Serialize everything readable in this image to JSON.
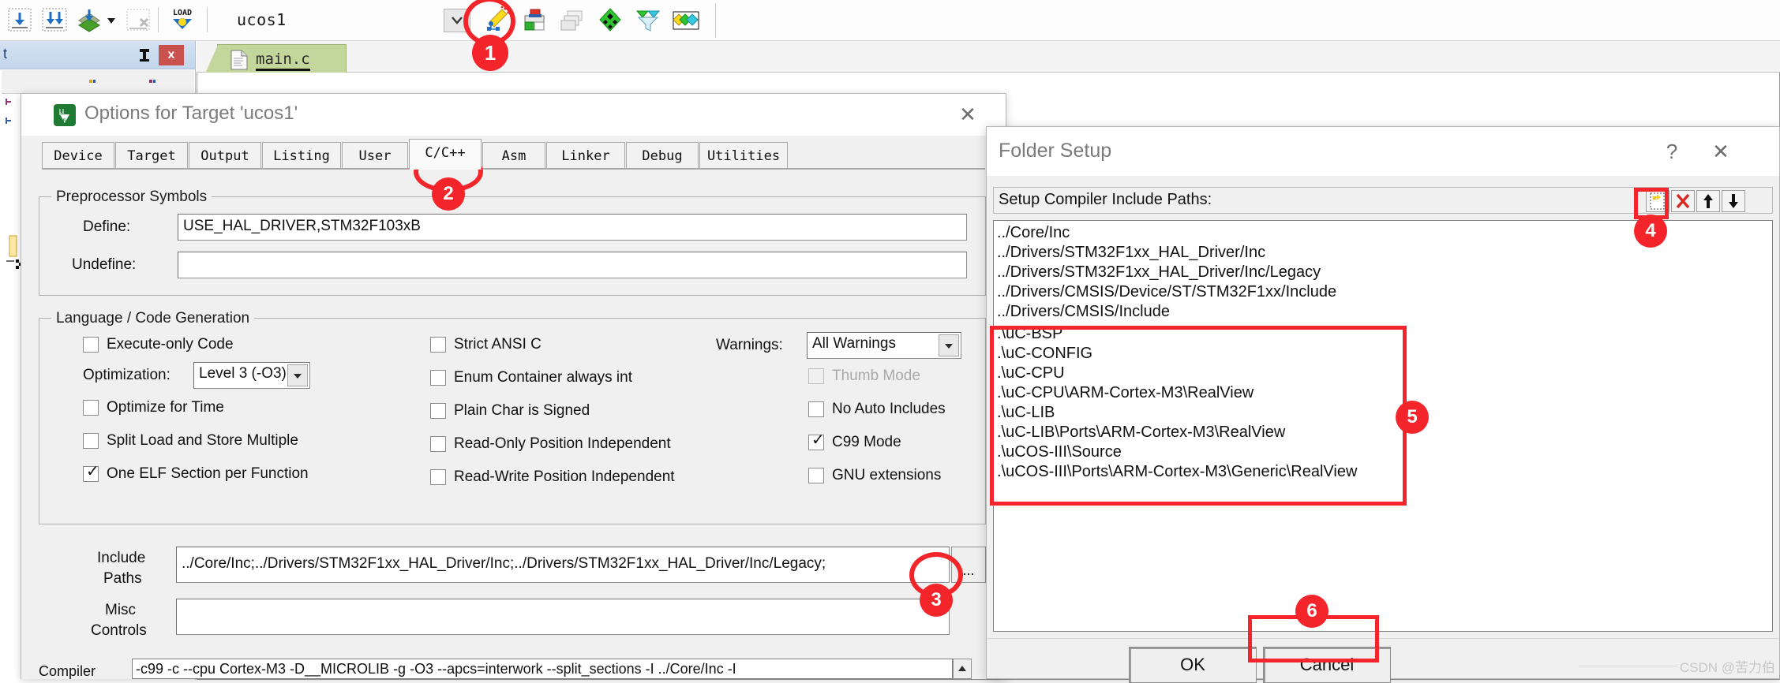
{
  "ide": {
    "project_name": "ucos1",
    "toolbar_icons": [
      "translate-file-icon",
      "build-target-icon",
      "rebuild-all-icon",
      "batch-build-dropdown-icon",
      "stop-build-icon",
      "load-flash-icon"
    ],
    "right_toolbar_icons": [
      "configure-target-wizard-icon",
      "manage-runtime-environment-icon",
      "manage-project-items-icon",
      "pack-installer-green-icon",
      "pack-filter-icon",
      "multi-project-icon"
    ],
    "project_combo_icon": "chevron-down-icon"
  },
  "left_panel": {
    "caption": "t",
    "pin_icon": "pin-icon",
    "close_icon": "close-icon"
  },
  "editor": {
    "tab_label": "main.c",
    "tab_icon": "c-file-icon"
  },
  "options_dialog": {
    "icon": "uvision5-icon",
    "title": "Options for Target 'ucos1'",
    "close_icon": "close-icon",
    "tabs": [
      {
        "label": "Device",
        "active": false
      },
      {
        "label": "Target",
        "active": false
      },
      {
        "label": "Output",
        "active": false
      },
      {
        "label": "Listing",
        "active": false
      },
      {
        "label": "User",
        "active": false
      },
      {
        "label": "C/C++",
        "active": true
      },
      {
        "label": "Asm",
        "active": false
      },
      {
        "label": "Linker",
        "active": false
      },
      {
        "label": "Debug",
        "active": false
      },
      {
        "label": "Utilities",
        "active": false
      }
    ],
    "preprocessor": {
      "caption": "Preprocessor Symbols",
      "define_label": "Define:",
      "define_value": "USE_HAL_DRIVER,STM32F103xB",
      "undefine_label": "Undefine:",
      "undefine_value": ""
    },
    "language": {
      "caption": "Language / Code Generation",
      "col1": [
        {
          "label": "Execute-only Code",
          "checked": false,
          "disabled": false
        },
        {
          "label": "Optimize for Time",
          "checked": false,
          "disabled": false
        },
        {
          "label": "Split Load and Store Multiple",
          "checked": false,
          "disabled": false
        },
        {
          "label": "One ELF Section per Function",
          "checked": true,
          "disabled": false
        }
      ],
      "optimization_label": "Optimization:",
      "optimization_value": "Level 3 (-O3)",
      "col2": [
        {
          "label": "Strict ANSI C",
          "checked": false,
          "disabled": false
        },
        {
          "label": "Enum Container always int",
          "checked": false,
          "disabled": false
        },
        {
          "label": "Plain Char is Signed",
          "checked": false,
          "disabled": false
        },
        {
          "label": "Read-Only Position Independent",
          "checked": false,
          "disabled": false
        },
        {
          "label": "Read-Write Position Independent",
          "checked": false,
          "disabled": false
        }
      ],
      "warnings_label": "Warnings:",
      "warnings_value": "All Warnings",
      "col3": [
        {
          "label": "Thumb Mode",
          "checked": false,
          "disabled": true
        },
        {
          "label": "No Auto Includes",
          "checked": false,
          "disabled": false
        },
        {
          "label": "C99 Mode",
          "checked": true,
          "disabled": false
        },
        {
          "label": "GNU extensions",
          "checked": false,
          "disabled": false
        }
      ]
    },
    "include_paths_label_1": "Include",
    "include_paths_label_2": "Paths",
    "include_paths_value": "../Core/Inc;../Drivers/STM32F1xx_HAL_Driver/Inc;../Drivers/STM32F1xx_HAL_Driver/Inc/Legacy;",
    "include_browse_label": "...",
    "misc_label_1": "Misc",
    "misc_label_2": "Controls",
    "misc_value": "",
    "compiler_label": "Compiler",
    "compiler_value": "-c99 -c --cpu Cortex-M3 -D__MICROLIB -g -O3 --apcs=interwork --split_sections -I ../Core/Inc -I"
  },
  "folder_dialog": {
    "title": "Folder Setup",
    "help_label": "?",
    "close_label": "✕",
    "bar_label": "Setup Compiler Include Paths:",
    "toolbar": [
      {
        "name": "new-path-icon",
        "glyph": ""
      },
      {
        "name": "delete-path-icon",
        "glyph": "✕"
      },
      {
        "name": "move-up-icon",
        "glyph": "↑"
      },
      {
        "name": "move-down-icon",
        "glyph": "↓"
      }
    ],
    "paths": [
      "../Core/Inc",
      "../Drivers/STM32F1xx_HAL_Driver/Inc",
      "../Drivers/STM32F1xx_HAL_Driver/Inc/Legacy",
      "../Drivers/CMSIS/Device/ST/STM32F1xx/Include",
      "../Drivers/CMSIS/Include",
      ".\\uC-BSP",
      ".\\uC-CONFIG",
      ".\\uC-CPU",
      ".\\uC-CPU\\ARM-Cortex-M3\\RealView",
      ".\\uC-LIB",
      ".\\uC-LIB\\Ports\\ARM-Cortex-M3\\RealView",
      ".\\uCOS-III\\Source",
      ".\\uCOS-III\\Ports\\ARM-Cortex-M3\\Generic\\RealView"
    ],
    "ok_label": "OK",
    "cancel_label": "Cancel"
  },
  "annotations": {
    "accent_color": "#f4252a",
    "markers": [
      {
        "number": "1",
        "target": "configure-target-wizard-icon"
      },
      {
        "number": "2",
        "target": "tab-c-cpp"
      },
      {
        "number": "3",
        "target": "include-paths-browse-button"
      },
      {
        "number": "4",
        "target": "new-path-button"
      },
      {
        "number": "5",
        "target": "ucos-include-paths-group"
      },
      {
        "number": "6",
        "target": "ok-button"
      }
    ]
  },
  "watermark": "CSDN @苦力伯"
}
